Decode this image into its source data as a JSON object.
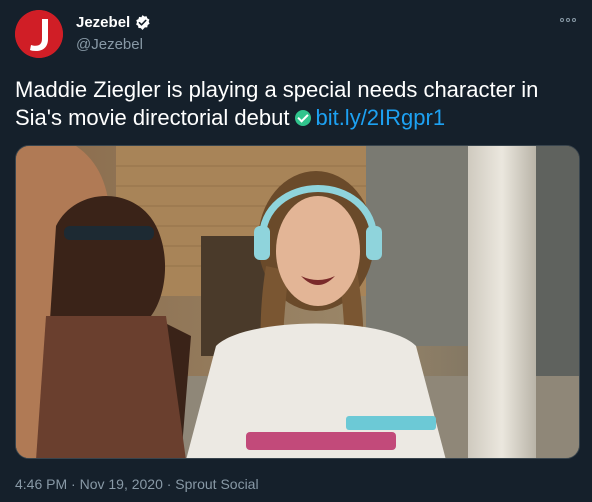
{
  "account": {
    "display_name": "Jezebel",
    "handle": "@Jezebel",
    "avatar_letter": "J",
    "brand_color": "#d01e26"
  },
  "tweet": {
    "text": "Maddie Ziegler is playing a special needs character in Sia's movie directorial debut",
    "link": "bit.ly/2IRgpr1"
  },
  "meta": {
    "timestamp": "4:46 PM · Nov 19, 2020 · Sprout Social"
  },
  "icons": {
    "verified": "verified-badge-icon",
    "more": "more-options-icon",
    "check": "green-check-emoji-icon"
  },
  "colors": {
    "background": "#15202b",
    "link": "#1da1f2",
    "muted": "#8899a6"
  }
}
